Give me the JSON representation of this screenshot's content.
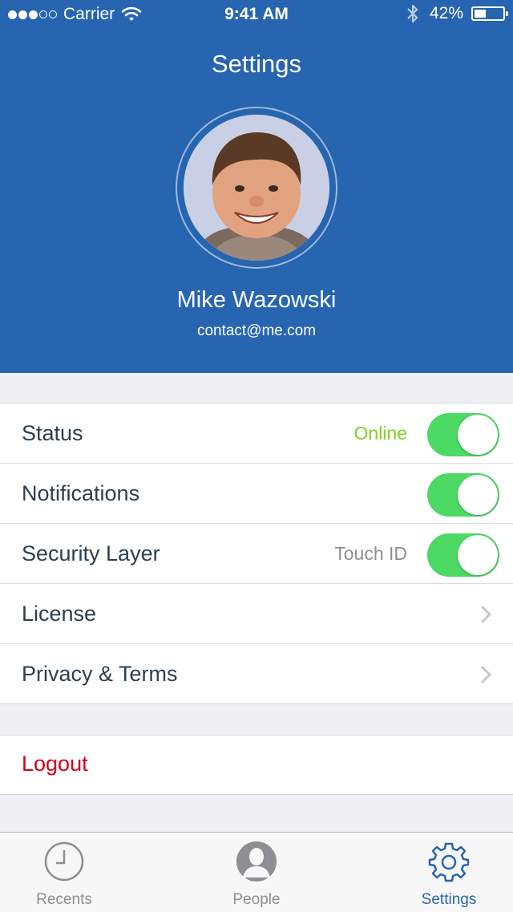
{
  "status_bar": {
    "signal_filled": 3,
    "signal_total": 5,
    "carrier": "Carrier",
    "time": "9:41 AM",
    "battery": "42%",
    "battery_level": 0.42,
    "icons": [
      "wifi-icon",
      "bluetooth-icon",
      "battery-icon"
    ]
  },
  "header": {
    "title": "Settings",
    "user_name": "Mike Wazowski",
    "email": "contact@me.com",
    "background_color": "#2765b0"
  },
  "settings_rows": [
    {
      "label": "Status",
      "value": "Online",
      "value_color": "#7ed321",
      "toggle": true,
      "toggle_on": true
    },
    {
      "label": "Notifications",
      "value": "",
      "toggle": true,
      "toggle_on": true
    },
    {
      "label": "Security Layer",
      "value": "Touch ID",
      "value_color": "#8e8e93",
      "toggle": true,
      "toggle_on": true
    },
    {
      "label": "License",
      "chevron": true
    },
    {
      "label": "Privacy & Terms",
      "chevron": true
    }
  ],
  "logout": {
    "label": "Logout",
    "color": "#d0021b"
  },
  "tab_bar": {
    "tabs": [
      {
        "label": "Recents",
        "icon": "clock-icon",
        "active": false
      },
      {
        "label": "People",
        "icon": "person-icon",
        "active": false
      },
      {
        "label": "Settings",
        "icon": "gear-icon",
        "active": true
      }
    ],
    "active_color": "#2765b0"
  }
}
